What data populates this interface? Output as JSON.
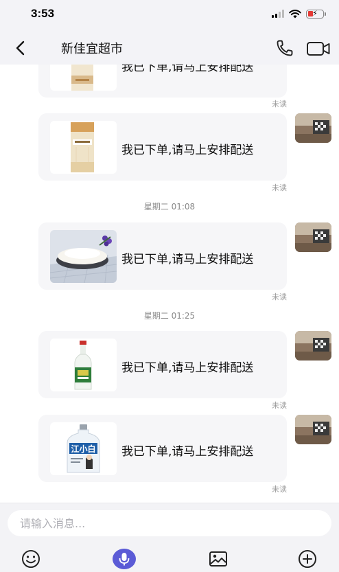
{
  "status": {
    "time": "3:53"
  },
  "header": {
    "title": "新佳宜超市"
  },
  "messages": [
    {
      "text": "我已下单,请马上安排配送",
      "status": "未读",
      "thumb": "rice-bag"
    },
    {
      "text": "我已下单,请马上安排配送",
      "status": "未读",
      "thumb": "rice-bag"
    },
    {
      "text": "我已下单,请马上安排配送",
      "status": "未读",
      "thumb": "rice-bowl"
    },
    {
      "text": "我已下单,请马上安排配送",
      "status": "未读",
      "thumb": "baijiu-bottle"
    },
    {
      "text": "我已下单,请马上安排配送",
      "status": "未读",
      "thumb": "jiangxiaobai-bottle"
    }
  ],
  "time_separators": [
    "星期二  01:08",
    "星期二  01:25"
  ],
  "product_labels": {
    "jiangxiaobai": "江小白"
  },
  "input": {
    "placeholder": "请输入消息..."
  },
  "colors": {
    "accent": "#5b5bd6",
    "bubble": "#f6f6f8",
    "header_bg": "#f3f3f7"
  }
}
